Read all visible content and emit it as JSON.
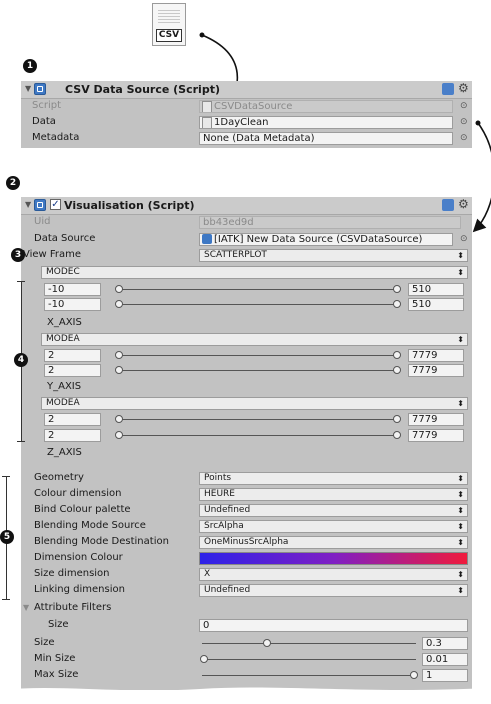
{
  "csv_file": {
    "label": "CSV"
  },
  "badges": [
    "1",
    "2",
    "3",
    "4",
    "5"
  ],
  "csv_component": {
    "title": "CSV Data Source (Script)",
    "rows": [
      {
        "label": "Script",
        "value": "CSVDataSource"
      },
      {
        "label": "Data",
        "value": "1DayClean"
      },
      {
        "label": "Metadata",
        "value": "None (Data Metadata)"
      }
    ]
  },
  "vis_component": {
    "title": "Visualisation (Script)",
    "uid_label": "Uid",
    "uid_value": "bb43ed9d",
    "data_source_label": "Data Source",
    "data_source_value": "[IATK] New Data Source (CSVDataSource)",
    "view_frame_label": "View Frame",
    "view_frame_value": "SCATTERPLOT",
    "axes": [
      {
        "dimension": "MODEC",
        "min": "-10",
        "max": "-10",
        "min_field": "510",
        "max_field": "510",
        "axis_label": "X_AXIS"
      },
      {
        "dimension": "MODEA",
        "min": "2",
        "max": "2",
        "min_field": "7779",
        "max_field": "7779",
        "axis_label": "Y_AXIS"
      },
      {
        "dimension": "MODEA",
        "min": "2",
        "max": "2",
        "min_field": "7779",
        "max_field": "7779",
        "axis_label": "Z_AXIS"
      }
    ],
    "props": [
      {
        "label": "Geometry",
        "value": "Points"
      },
      {
        "label": "Colour dimension",
        "value": "HEURE"
      },
      {
        "label": "Bind Colour palette",
        "value": "Undefined"
      },
      {
        "label": "Blending Mode Source",
        "value": "SrcAlpha"
      },
      {
        "label": "Blending Mode Destination",
        "value": "OneMinusSrcAlpha"
      },
      {
        "label": "Dimension Colour",
        "value": ""
      },
      {
        "label": "Size dimension",
        "value": "X"
      },
      {
        "label": "Linking dimension",
        "value": "Undefined"
      }
    ],
    "attribute_filters_label": "Attribute Filters",
    "filter_size_label": "Size",
    "filter_size_value": "0",
    "size_label": "Size",
    "size_value": "0.3",
    "min_size_label": "Min Size",
    "min_size_value": "0.01",
    "max_size_label": "Max Size",
    "max_size_value": "1"
  },
  "colors": {
    "gradient_start": "#2d22e8",
    "gradient_end": "#f01b3c"
  }
}
